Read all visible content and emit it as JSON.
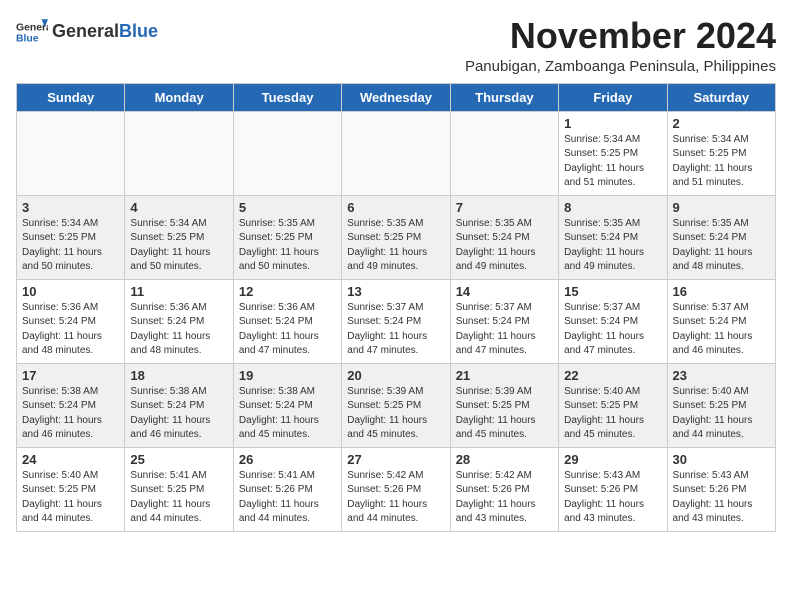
{
  "header": {
    "logo_general": "General",
    "logo_blue": "Blue",
    "month_year": "November 2024",
    "location": "Panubigan, Zamboanga Peninsula, Philippines"
  },
  "weekdays": [
    "Sunday",
    "Monday",
    "Tuesday",
    "Wednesday",
    "Thursday",
    "Friday",
    "Saturday"
  ],
  "weeks": [
    {
      "shaded": false,
      "days": [
        {
          "num": "",
          "info": ""
        },
        {
          "num": "",
          "info": ""
        },
        {
          "num": "",
          "info": ""
        },
        {
          "num": "",
          "info": ""
        },
        {
          "num": "",
          "info": ""
        },
        {
          "num": "1",
          "info": "Sunrise: 5:34 AM\nSunset: 5:25 PM\nDaylight: 11 hours\nand 51 minutes."
        },
        {
          "num": "2",
          "info": "Sunrise: 5:34 AM\nSunset: 5:25 PM\nDaylight: 11 hours\nand 51 minutes."
        }
      ]
    },
    {
      "shaded": true,
      "days": [
        {
          "num": "3",
          "info": "Sunrise: 5:34 AM\nSunset: 5:25 PM\nDaylight: 11 hours\nand 50 minutes."
        },
        {
          "num": "4",
          "info": "Sunrise: 5:34 AM\nSunset: 5:25 PM\nDaylight: 11 hours\nand 50 minutes."
        },
        {
          "num": "5",
          "info": "Sunrise: 5:35 AM\nSunset: 5:25 PM\nDaylight: 11 hours\nand 50 minutes."
        },
        {
          "num": "6",
          "info": "Sunrise: 5:35 AM\nSunset: 5:25 PM\nDaylight: 11 hours\nand 49 minutes."
        },
        {
          "num": "7",
          "info": "Sunrise: 5:35 AM\nSunset: 5:24 PM\nDaylight: 11 hours\nand 49 minutes."
        },
        {
          "num": "8",
          "info": "Sunrise: 5:35 AM\nSunset: 5:24 PM\nDaylight: 11 hours\nand 49 minutes."
        },
        {
          "num": "9",
          "info": "Sunrise: 5:35 AM\nSunset: 5:24 PM\nDaylight: 11 hours\nand 48 minutes."
        }
      ]
    },
    {
      "shaded": false,
      "days": [
        {
          "num": "10",
          "info": "Sunrise: 5:36 AM\nSunset: 5:24 PM\nDaylight: 11 hours\nand 48 minutes."
        },
        {
          "num": "11",
          "info": "Sunrise: 5:36 AM\nSunset: 5:24 PM\nDaylight: 11 hours\nand 48 minutes."
        },
        {
          "num": "12",
          "info": "Sunrise: 5:36 AM\nSunset: 5:24 PM\nDaylight: 11 hours\nand 47 minutes."
        },
        {
          "num": "13",
          "info": "Sunrise: 5:37 AM\nSunset: 5:24 PM\nDaylight: 11 hours\nand 47 minutes."
        },
        {
          "num": "14",
          "info": "Sunrise: 5:37 AM\nSunset: 5:24 PM\nDaylight: 11 hours\nand 47 minutes."
        },
        {
          "num": "15",
          "info": "Sunrise: 5:37 AM\nSunset: 5:24 PM\nDaylight: 11 hours\nand 47 minutes."
        },
        {
          "num": "16",
          "info": "Sunrise: 5:37 AM\nSunset: 5:24 PM\nDaylight: 11 hours\nand 46 minutes."
        }
      ]
    },
    {
      "shaded": true,
      "days": [
        {
          "num": "17",
          "info": "Sunrise: 5:38 AM\nSunset: 5:24 PM\nDaylight: 11 hours\nand 46 minutes."
        },
        {
          "num": "18",
          "info": "Sunrise: 5:38 AM\nSunset: 5:24 PM\nDaylight: 11 hours\nand 46 minutes."
        },
        {
          "num": "19",
          "info": "Sunrise: 5:38 AM\nSunset: 5:24 PM\nDaylight: 11 hours\nand 45 minutes."
        },
        {
          "num": "20",
          "info": "Sunrise: 5:39 AM\nSunset: 5:25 PM\nDaylight: 11 hours\nand 45 minutes."
        },
        {
          "num": "21",
          "info": "Sunrise: 5:39 AM\nSunset: 5:25 PM\nDaylight: 11 hours\nand 45 minutes."
        },
        {
          "num": "22",
          "info": "Sunrise: 5:40 AM\nSunset: 5:25 PM\nDaylight: 11 hours\nand 45 minutes."
        },
        {
          "num": "23",
          "info": "Sunrise: 5:40 AM\nSunset: 5:25 PM\nDaylight: 11 hours\nand 44 minutes."
        }
      ]
    },
    {
      "shaded": false,
      "days": [
        {
          "num": "24",
          "info": "Sunrise: 5:40 AM\nSunset: 5:25 PM\nDaylight: 11 hours\nand 44 minutes."
        },
        {
          "num": "25",
          "info": "Sunrise: 5:41 AM\nSunset: 5:25 PM\nDaylight: 11 hours\nand 44 minutes."
        },
        {
          "num": "26",
          "info": "Sunrise: 5:41 AM\nSunset: 5:26 PM\nDaylight: 11 hours\nand 44 minutes."
        },
        {
          "num": "27",
          "info": "Sunrise: 5:42 AM\nSunset: 5:26 PM\nDaylight: 11 hours\nand 44 minutes."
        },
        {
          "num": "28",
          "info": "Sunrise: 5:42 AM\nSunset: 5:26 PM\nDaylight: 11 hours\nand 43 minutes."
        },
        {
          "num": "29",
          "info": "Sunrise: 5:43 AM\nSunset: 5:26 PM\nDaylight: 11 hours\nand 43 minutes."
        },
        {
          "num": "30",
          "info": "Sunrise: 5:43 AM\nSunset: 5:26 PM\nDaylight: 11 hours\nand 43 minutes."
        }
      ]
    }
  ]
}
